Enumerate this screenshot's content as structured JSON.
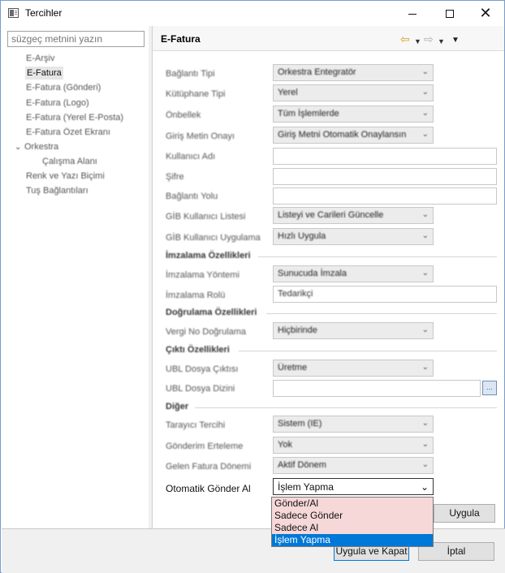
{
  "window": {
    "title": "Tercihler"
  },
  "sidebar": {
    "filter_placeholder": "süzgeç metnini yazın",
    "items": [
      {
        "label": "E-Arşiv"
      },
      {
        "label": "E-Fatura"
      },
      {
        "label": "E-Fatura (Gönderi)"
      },
      {
        "label": "E-Fatura (Logo)"
      },
      {
        "label": "E-Fatura (Yerel E-Posta)"
      },
      {
        "label": "E-Fatura Özet Ekranı"
      },
      {
        "label": "Orkestra"
      },
      {
        "label": "Çalışma Alanı"
      },
      {
        "label": "Renk ve Yazı Biçimi"
      },
      {
        "label": "Tuş Bağlantıları"
      }
    ]
  },
  "page": {
    "title": "E-Fatura"
  },
  "form": {
    "baglanti_tipi": {
      "label": "Bağlantı Tipi",
      "value": "Orkestra Entegratör"
    },
    "kutuphane_tipi": {
      "label": "Kütüphane Tipi",
      "value": "Yerel"
    },
    "onbellek": {
      "label": "Önbellek",
      "value": "Tüm İşlemlerde"
    },
    "giris_metin_onayi": {
      "label": "Giriş Metin Onayı",
      "value": "Giriş Metni Otomatik Onaylansın"
    },
    "kullanici_adi": {
      "label": "Kullanıcı Adı",
      "value": ""
    },
    "sifre": {
      "label": "Şifre",
      "value": ""
    },
    "baglanti_yolu": {
      "label": "Bağlantı Yolu",
      "value": ""
    },
    "gib_kullanici_listesi": {
      "label": "GİB Kullanıcı Listesi",
      "value": "Listeyi ve Carileri Güncelle"
    },
    "gib_kullanici_uygulama": {
      "label": "GİB Kullanıcı Uygulama",
      "value": "Hızlı Uygula"
    },
    "imzalama_section": "İmzalama Özellikleri",
    "imzalama_yontemi": {
      "label": "İmzalama Yöntemi",
      "value": "Sunucuda İmzala"
    },
    "imzalama_rolu": {
      "label": "İmzalama Rolü",
      "value": "Tedarikçi"
    },
    "dogrulama_section": "Doğrulama Özellikleri",
    "vergi_no_dogrulama": {
      "label": "Vergi No Doğrulama",
      "value": "Hiçbirinde"
    },
    "cikti_section": "Çıktı Özellikleri",
    "ubl_dosya_ciktisi": {
      "label": "UBL Dosya Çıktısı",
      "value": "Üretme"
    },
    "ubl_dosya_dizini": {
      "label": "UBL Dosya Dizini",
      "value": ""
    },
    "browse_label": "...",
    "diger_section": "Diğer",
    "tarayici_tercihi": {
      "label": "Tarayıcı Tercihi",
      "value": "Sistem (IE)"
    },
    "gonderim_erteleme": {
      "label": "Gönderim Erteleme",
      "value": "Yok"
    },
    "gelen_fatura_donemi": {
      "label": "Gelen Fatura Dönemi",
      "value": "Aktif Dönem"
    },
    "otomatik_gonder_al": {
      "label": "Otomatik Gönder Al",
      "value": "İşlem Yapma"
    }
  },
  "dropdown": {
    "options": [
      "Gönder/Al",
      "Sadece Gönder",
      "Sadece Al",
      "İşlem Yapma"
    ],
    "selected_index": 3
  },
  "buttons": {
    "apply": "Uygula",
    "apply_close": "Uygula ve Kapat",
    "cancel": "İptal"
  },
  "icons": {
    "back": "back-arrow-icon",
    "forward": "forward-arrow-icon",
    "menu": "view-menu-icon"
  },
  "colors": {
    "selection": "#0078d7",
    "dropdown_option_bg": "#f7d8d8",
    "back_arrow": "#d7a020"
  }
}
